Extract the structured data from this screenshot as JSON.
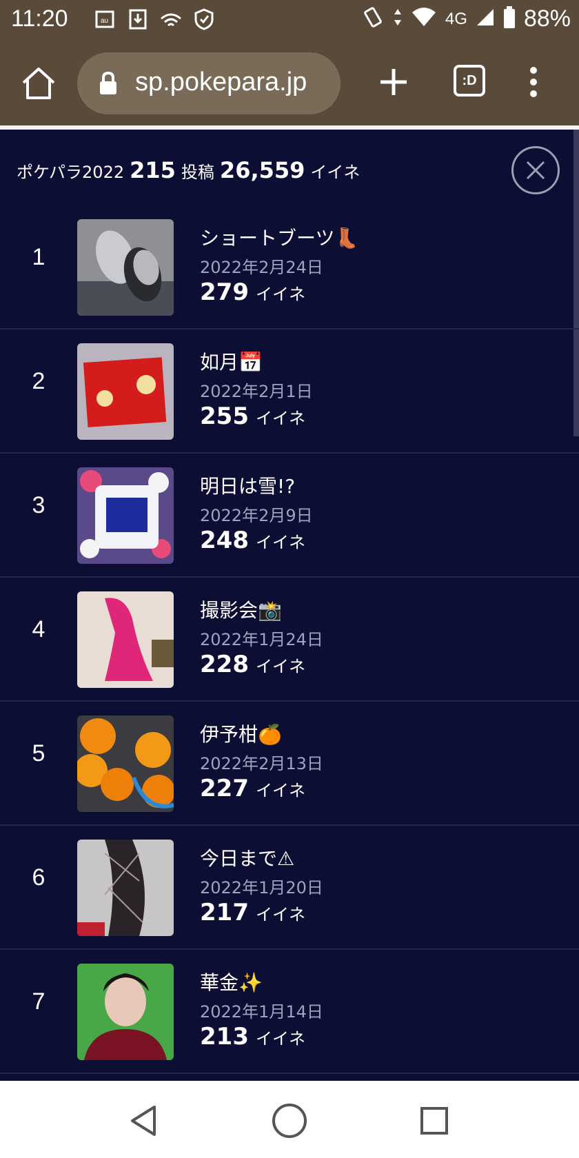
{
  "status_bar": {
    "time": "11:20",
    "network": "4G",
    "battery": "88%"
  },
  "browser": {
    "url": "sp.pokepara.jp",
    "tabs_label": ":D"
  },
  "header": {
    "prefix": "ポケパラ2022",
    "posts_count": "215",
    "posts_label": "投稿",
    "likes_count": "26,559",
    "likes_label": "イイネ"
  },
  "posts": [
    {
      "rank": "1",
      "title": "ショートブーツ👢",
      "date": "2022年2月24日",
      "likes": "279",
      "likes_unit": "イイネ",
      "thumb_desc": "silver-boots"
    },
    {
      "rank": "2",
      "title": "如月📅",
      "date": "2022年2月1日",
      "likes": "255",
      "likes_unit": "イイネ",
      "thumb_desc": "red-envelope"
    },
    {
      "rank": "3",
      "title": "明日は雪!?",
      "date": "2022年2月9日",
      "likes": "248",
      "likes_unit": "イイネ",
      "thumb_desc": "sake-lees-pack"
    },
    {
      "rank": "4",
      "title": "撮影会📸",
      "date": "2022年1月24日",
      "likes": "228",
      "likes_unit": "イイネ",
      "thumb_desc": "pink-kimono"
    },
    {
      "rank": "5",
      "title": "伊予柑🍊",
      "date": "2022年2月13日",
      "likes": "227",
      "likes_unit": "イイネ",
      "thumb_desc": "oranges"
    },
    {
      "rank": "6",
      "title": "今日まで⚠",
      "date": "2022年1月20日",
      "likes": "217",
      "likes_unit": "イイネ",
      "thumb_desc": "lace-stockings"
    },
    {
      "rank": "7",
      "title": "華金✨",
      "date": "2022年1月14日",
      "likes": "213",
      "likes_unit": "イイネ",
      "thumb_desc": "portrait"
    }
  ]
}
